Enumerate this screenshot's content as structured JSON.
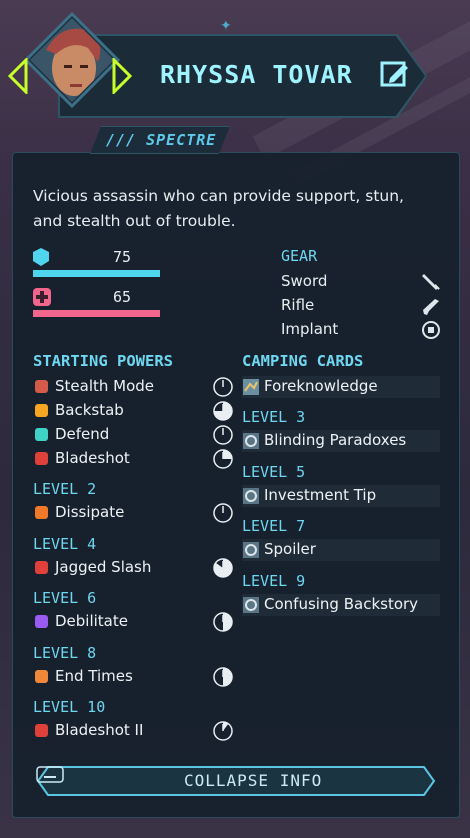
{
  "character": {
    "name": "RHYSSA TOVAR",
    "class": "/// SPECTRE",
    "description": "Vicious assassin who can provide support, stun, and stealth out of trouble."
  },
  "stats": {
    "shield": {
      "value": "75",
      "color": "#4fd6ee"
    },
    "health": {
      "value": "65",
      "color": "#f2668e"
    }
  },
  "gear": {
    "title": "GEAR",
    "items": [
      {
        "label": "Sword",
        "icon": "sword-icon"
      },
      {
        "label": "Rifle",
        "icon": "rifle-icon"
      },
      {
        "label": "Implant",
        "icon": "implant-icon"
      }
    ]
  },
  "powers": {
    "title": "STARTING POWERS",
    "starting": [
      {
        "label": "Stealth Mode",
        "icon": "stealth-icon",
        "cooldown": 0.0
      },
      {
        "label": "Backstab",
        "icon": "backstab-icon",
        "cooldown": 0.75
      },
      {
        "label": "Defend",
        "icon": "defend-icon",
        "cooldown": 0.0
      },
      {
        "label": "Bladeshot",
        "icon": "bladeshot-icon",
        "cooldown": 0.25
      }
    ],
    "levels": [
      {
        "level": "LEVEL 2",
        "label": "Dissipate",
        "icon": "dissipate-icon",
        "cooldown": 0.0
      },
      {
        "level": "LEVEL 4",
        "label": "Jagged Slash",
        "icon": "jagged-slash-icon",
        "cooldown": 0.85
      },
      {
        "level": "LEVEL 6",
        "label": "Debilitate",
        "icon": "debilitate-icon",
        "cooldown": 0.5
      },
      {
        "level": "LEVEL 8",
        "label": "End Times",
        "icon": "end-times-icon",
        "cooldown": 0.5
      },
      {
        "level": "LEVEL 10",
        "label": "Bladeshot II",
        "icon": "bladeshot-icon",
        "cooldown": 0.1
      }
    ]
  },
  "cards": {
    "title": "CAMPING CARDS",
    "starting": {
      "label": "Foreknowledge",
      "icon": "card-icon"
    },
    "levels": [
      {
        "level": "LEVEL 3",
        "label": "Blinding Paradoxes"
      },
      {
        "level": "LEVEL 5",
        "label": "Investment Tip"
      },
      {
        "level": "LEVEL 7",
        "label": "Spoiler"
      },
      {
        "level": "LEVEL 9",
        "label": "Confusing Backstory"
      }
    ]
  },
  "footer": {
    "collapse_label": "COLLAPSE INFO"
  },
  "colors": {
    "accent": "#6fd7f0",
    "panel": "#16202c",
    "frame": "#2e5466",
    "arrow": "#c8ff2a"
  }
}
